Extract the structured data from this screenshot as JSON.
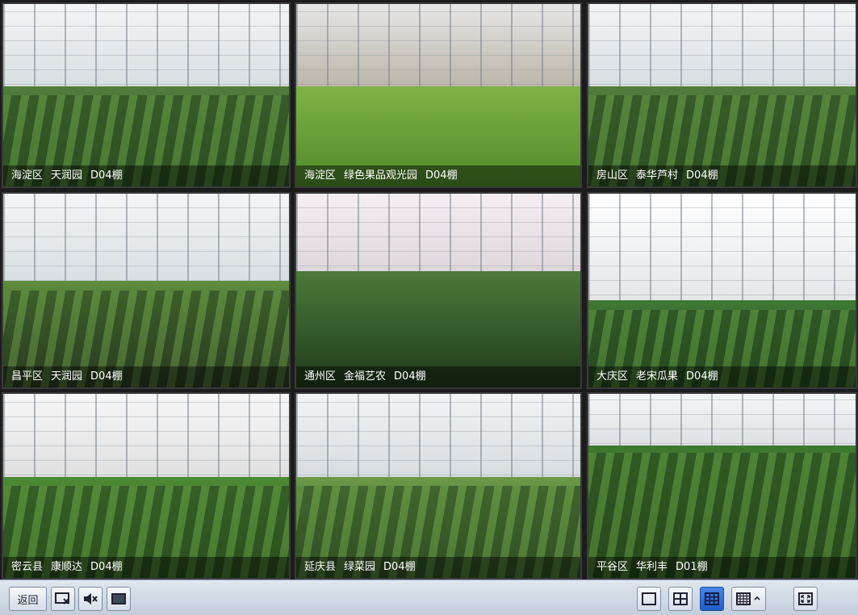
{
  "cells": [
    {
      "district": "海淀区",
      "site": "天润园",
      "shed": "D04棚"
    },
    {
      "district": "海淀区",
      "site": "绿色果品观光园",
      "shed": "D04棚"
    },
    {
      "district": "房山区",
      "site": "泰华芦村",
      "shed": "D04棚"
    },
    {
      "district": "昌平区",
      "site": "天润园",
      "shed": "D04棚"
    },
    {
      "district": "通州区",
      "site": "金福艺农",
      "shed": "D04棚"
    },
    {
      "district": "大庆区",
      "site": "老宋瓜果",
      "shed": "D04棚"
    },
    {
      "district": "密云县",
      "site": "康顺达",
      "shed": "D04棚"
    },
    {
      "district": "延庆县",
      "site": "绿菜园",
      "shed": "D04棚"
    },
    {
      "district": "平谷区",
      "site": "华利丰",
      "shed": "D01棚"
    }
  ],
  "toolbar": {
    "back_label": "返回",
    "icons": [
      "close-screen-icon",
      "mute-icon",
      "single-screen-icon",
      "layout-1-icon",
      "layout-4-icon",
      "layout-9-icon",
      "layout-16-icon",
      "fullscreen-icon"
    ],
    "active_layout": "layout-9"
  },
  "colors": {
    "active": "#2f6fd6",
    "caption_bg": "#000000"
  }
}
